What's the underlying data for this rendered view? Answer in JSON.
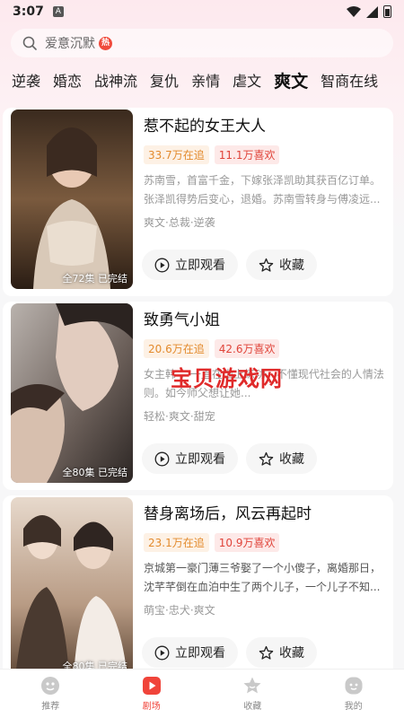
{
  "status": {
    "time": "3:07",
    "notif": "A"
  },
  "search": {
    "placeholder": "爱意沉默",
    "hot_badge": "热"
  },
  "tabs": [
    "逆袭",
    "婚恋",
    "战神流",
    "复仇",
    "亲情",
    "虐文",
    "爽文",
    "智商在线"
  ],
  "active_tab": "爽文",
  "dramas": [
    {
      "title": "惹不起的女王大人",
      "follow": "33.7万在追",
      "likes": "11.1万喜欢",
      "desc": "苏南雪，首富千金，下嫁张泽凯助其获百亿订单。张泽凯得势后变心，退婚。苏南雪转身与傅凌远...",
      "tags": "爽文·总裁·逆袭",
      "episodes": "全72集  已完结",
      "poster_text": "惹不起的女王大人",
      "watch_label": "立即观看",
      "fav_label": "收藏"
    },
    {
      "title": "致勇气小姐",
      "follow": "20.6万在追",
      "likes": "42.6万喜欢",
      "desc": "女主韩          ，一直在山上练功，不懂现代社会的人情法则。如今师父想让她...",
      "tags": "轻松·爽文·甜宠",
      "episodes": "全80集  已完结",
      "poster_text": "致勇气小姐",
      "watch_label": "立即观看",
      "fav_label": "收藏"
    },
    {
      "title": "替身离场后，风云再起时",
      "follow": "23.1万在追",
      "likes": "10.9万喜欢",
      "desc": "京城第一豪门薄三爷娶了一个小傻子，离婚那日，沈芊芊倒在血泊中生了两个儿子，一个儿子不知...",
      "tags": "萌宝·忠犬·爽文",
      "episodes": "全80集  已完结",
      "poster_text": "替身离场后，风云再起时",
      "watch_label": "立即观看",
      "fav_label": "收藏"
    }
  ],
  "watermark": "宝贝游戏网",
  "bottom_nav": [
    {
      "label": "推荐",
      "icon": "recommend-icon"
    },
    {
      "label": "剧场",
      "icon": "theater-icon"
    },
    {
      "label": "收藏",
      "icon": "favorites-icon"
    },
    {
      "label": "我的",
      "icon": "profile-icon"
    }
  ],
  "colors": {
    "accent": "#f0443a",
    "follow": "#e38b2e",
    "like": "#e0443a"
  }
}
